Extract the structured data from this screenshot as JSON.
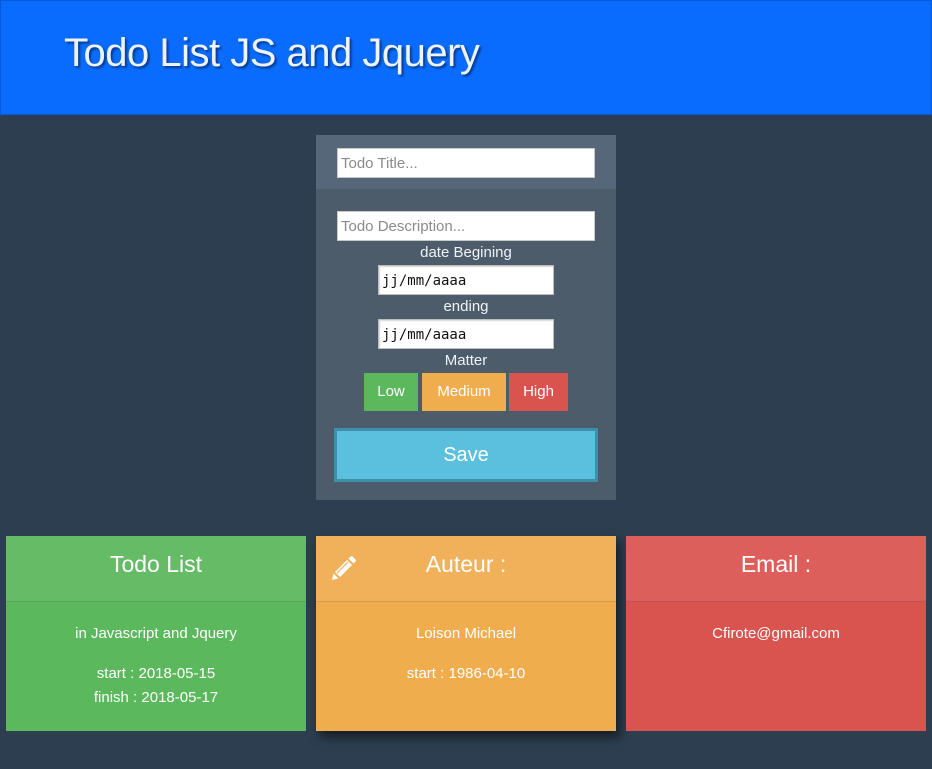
{
  "header": {
    "title": "Todo List JS and Jquery"
  },
  "form": {
    "title_placeholder": "Todo Title...",
    "description_placeholder": "Todo Description...",
    "date_begin_label": "date Begining",
    "date_begin_value": "jj/mm/aaaa",
    "date_end_label": "ending",
    "date_end_value": "jj/mm/aaaa",
    "matter_label": "Matter",
    "priority": {
      "low": "Low",
      "medium": "Medium",
      "high": "High"
    },
    "save_label": "Save"
  },
  "cards": [
    {
      "title": "Todo List",
      "lines": [
        "in Javascript and Jquery",
        "start : 2018-05-15",
        "finish : 2018-05-17"
      ],
      "color": "#5cb85c"
    },
    {
      "title": "Auteur :",
      "icon": "pencil-icon",
      "lines": [
        "Loison Michael",
        "start : 1986-04-10"
      ],
      "color": "#f0ad4e"
    },
    {
      "title": "Email :",
      "lines": [
        "Cfirote@gmail.com"
      ],
      "color": "#d9534f"
    }
  ],
  "colors": {
    "header": "#0a6cff",
    "background": "#2c3e50",
    "panel": "#4d5c6b",
    "save": "#5bc0de"
  }
}
